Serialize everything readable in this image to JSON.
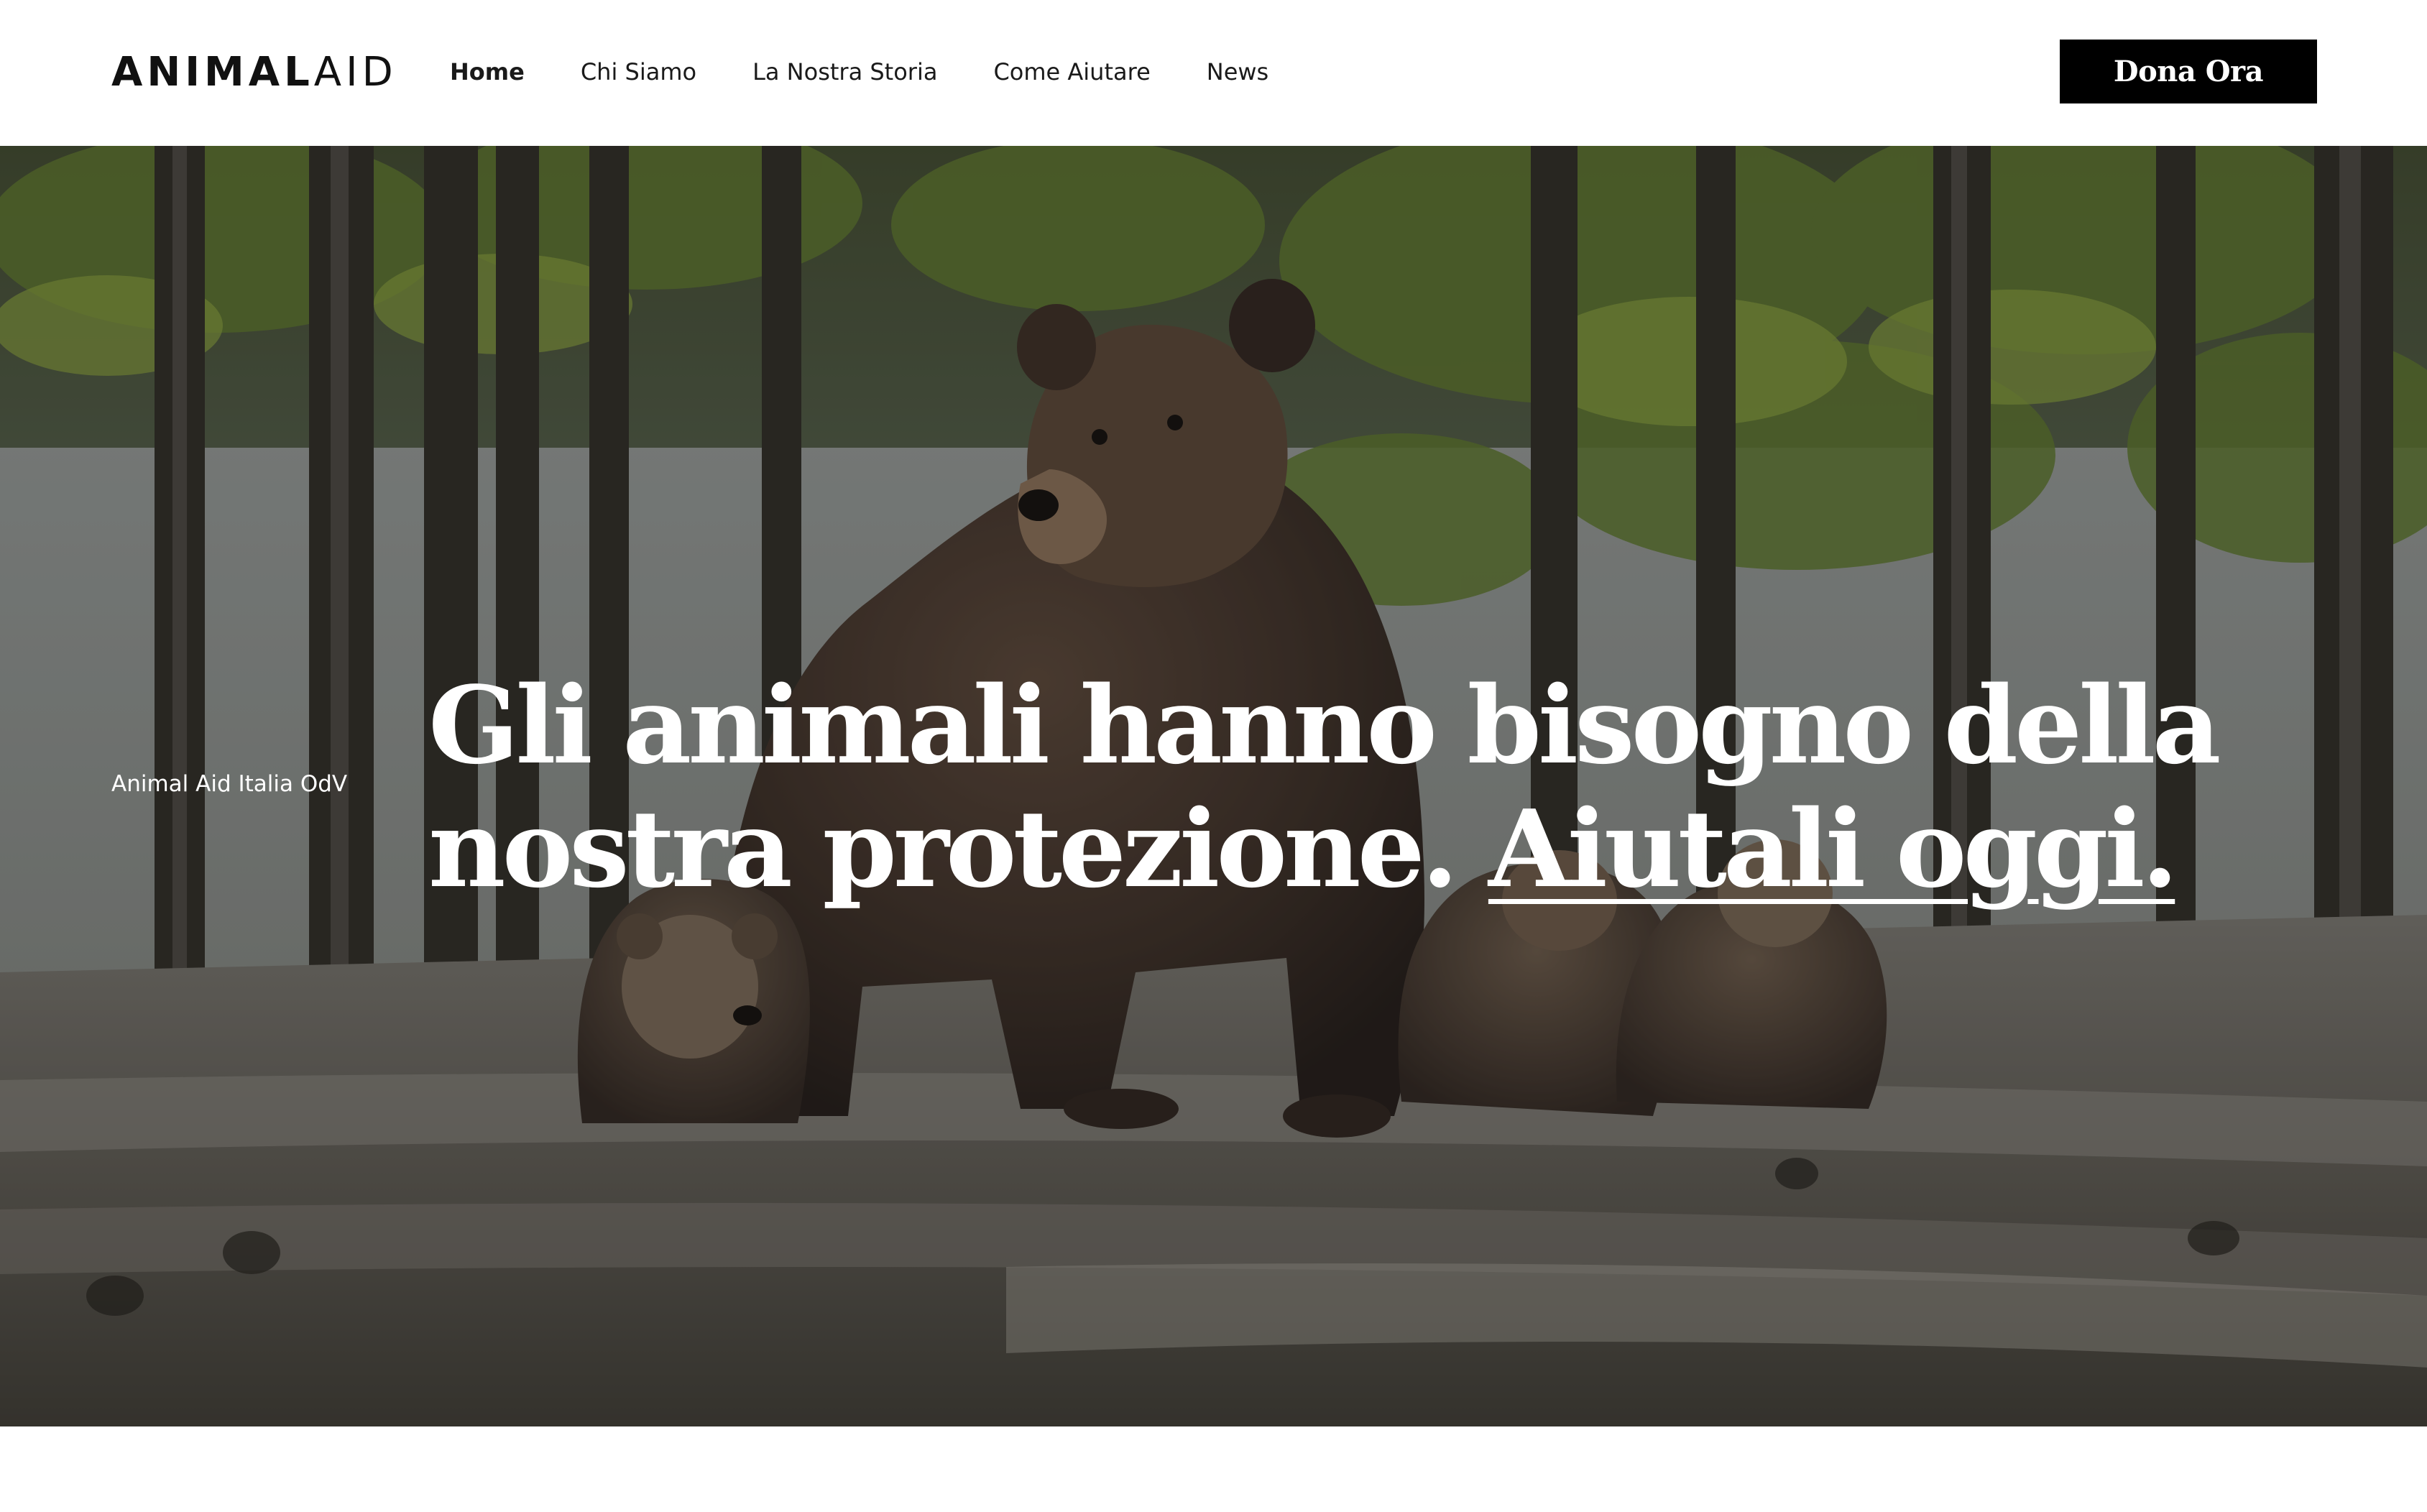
{
  "header": {
    "logo_bold": "ANIMAL",
    "logo_light": "AID",
    "nav": [
      {
        "label": "Home",
        "active": true
      },
      {
        "label": "Chi Siamo",
        "active": false
      },
      {
        "label": "La Nostra Storia",
        "active": false
      },
      {
        "label": "Come Aiutare",
        "active": false
      },
      {
        "label": "News",
        "active": false
      }
    ],
    "donate_label": "Dona Ora"
  },
  "hero": {
    "org_label": "Animal Aid Italia OdV",
    "headline_line1": "Gli animali hanno bisogno della",
    "headline_line2": "nostra protezione.",
    "headline_cta": "Aiutali oggi.",
    "image_subject": "grizzly-bear-with-cubs-on-fallen-logs-in-forest"
  },
  "colors": {
    "header_bg": "#ffffff",
    "donate_bg": "#000000",
    "donate_text": "#ffffff",
    "hero_text": "#ffffff"
  }
}
